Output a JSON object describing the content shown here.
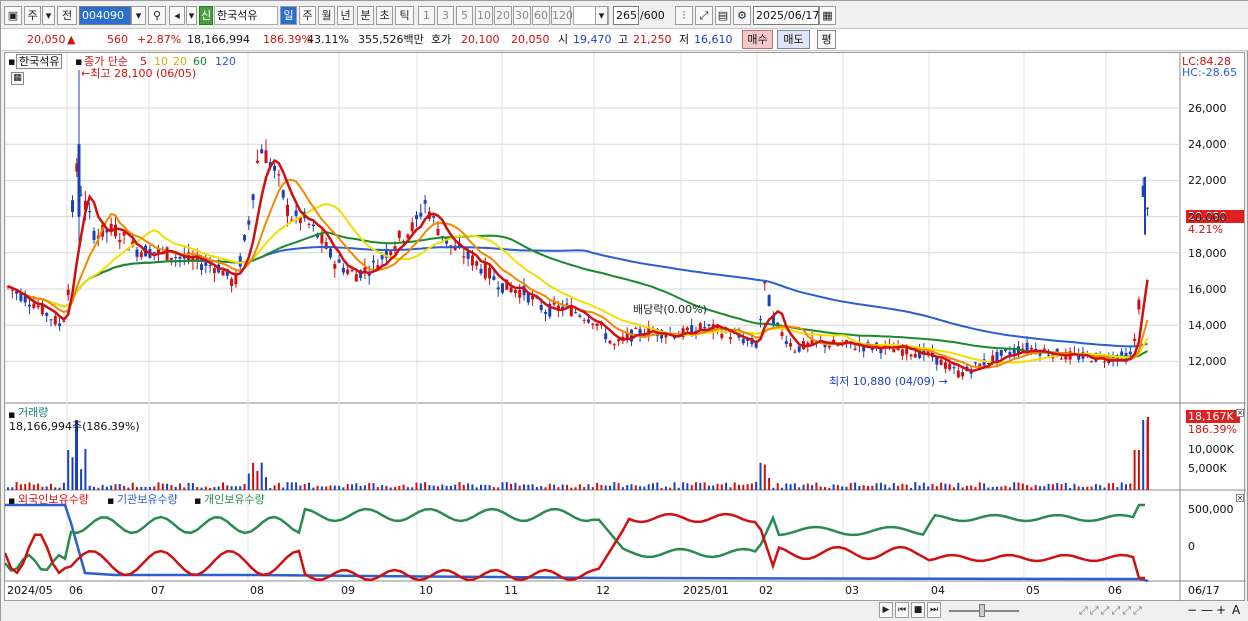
{
  "toolbar": {
    "type_label": "주",
    "prev_label": "전",
    "code": "004090",
    "stock_badge": "신",
    "stock_name": "한국석유",
    "periods": [
      "일",
      "주",
      "월",
      "년",
      "분",
      "초",
      "틱"
    ],
    "nums": [
      "1",
      "3",
      "5",
      "10",
      "20",
      "30",
      "60",
      "120"
    ],
    "count": "265",
    "count_total": "/600",
    "date": "2025/06/17"
  },
  "quote": {
    "price": "20,050",
    "arrow": "▲",
    "change": "560",
    "change_pct": "+2.87%",
    "volume": "18,166,994",
    "vol_pct": "186.39%",
    "turnover": "43.11%",
    "amount": "355,526백만",
    "bid_label": "호가",
    "bid1": "20,100",
    "bid2": "20,050",
    "open_label": "시",
    "open": "19,470",
    "high_label": "고",
    "high": "21,250",
    "low_label": "저",
    "low": "16,610",
    "buy_label": "매수",
    "sell_label": "매도",
    "eval_label": "평"
  },
  "price_panel": {
    "stock_tag": "한국석유",
    "ma_title": "종가 단순",
    "ma_periods": [
      "5",
      "10",
      "20",
      "60",
      "120"
    ],
    "high_note": "최고 28,100 (06/05)",
    "low_note": "최저 10,880 (04/09)",
    "div_note": "배당락(0.00%)",
    "lc": "LC:84.28",
    "hc": "HC:-28.65",
    "last_price": "20,050",
    "last_pct": "4.21%",
    "y_ticks": [
      "26,000",
      "24,000",
      "22,000",
      "20,000",
      "18,000",
      "16,000",
      "14,000",
      "12,000"
    ]
  },
  "volume_panel": {
    "title": "거래량",
    "value": "18,166,994주(186.39%)",
    "last": "18,167K",
    "last_pct": "186.39%",
    "y_ticks": [
      "10,000K",
      "5,000K"
    ]
  },
  "holding_panel": {
    "s1": "외국인보유수량",
    "s2": "기관보유수량",
    "s3": "개인보유수량",
    "y_ticks": [
      "500,000",
      "0"
    ]
  },
  "x_axis": [
    "2024/05",
    "06",
    "07",
    "08",
    "09",
    "10",
    "11",
    "12",
    "2025/01",
    "02",
    "03",
    "04",
    "05",
    "06",
    "06/17"
  ],
  "colors": {
    "up": "#d01010",
    "down": "#1a3fc0",
    "ma5": "#d01010",
    "ma10": "#f08a00",
    "ma20": "#f0e000",
    "ma60": "#1a8a2a",
    "ma120": "#2a5fd0",
    "foreign": "#d01010",
    "inst": "#2a5fd0",
    "indiv": "#2a8a50"
  }
}
